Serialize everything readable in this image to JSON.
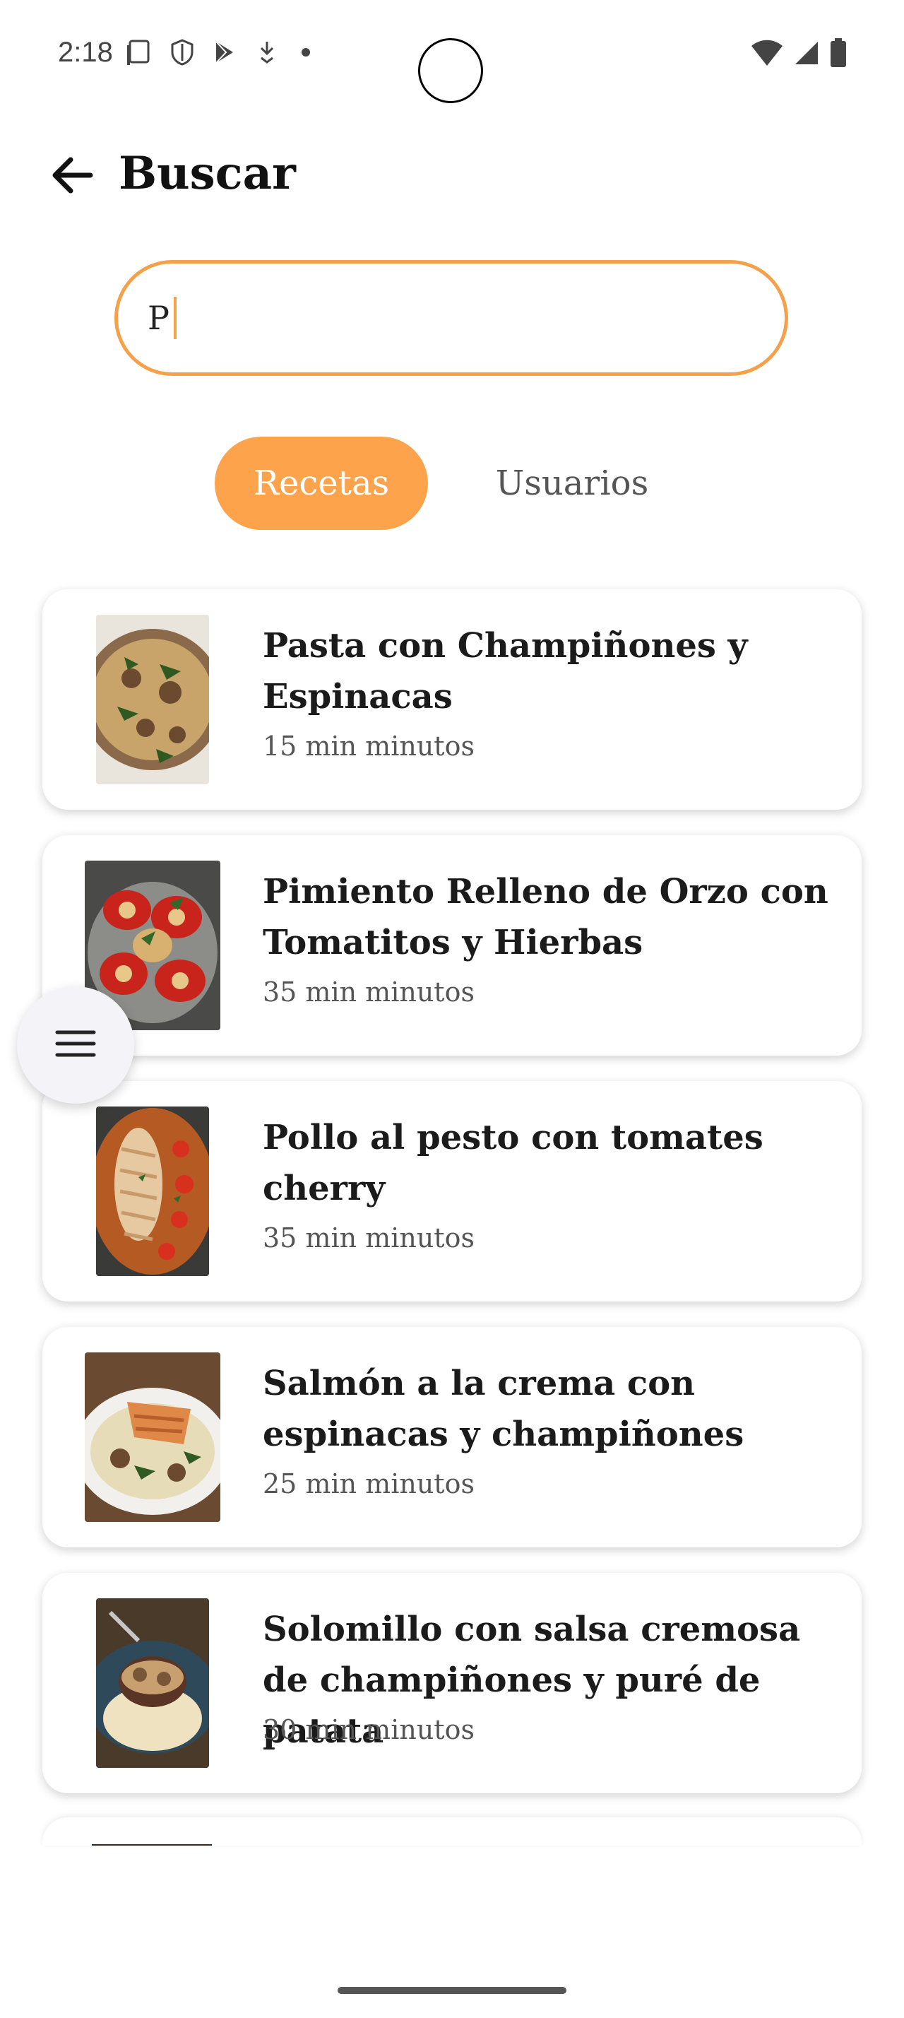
{
  "status_bar": {
    "time": "2:18",
    "icons_left": [
      "notification-screen-icon",
      "shield-icon",
      "play-store-icon",
      "download-icon",
      "dot-icon"
    ],
    "icons_right": [
      "wifi-icon",
      "signal-icon",
      "battery-icon"
    ]
  },
  "header": {
    "title": "Buscar",
    "back_icon": "arrow-left-icon"
  },
  "search": {
    "value": "P"
  },
  "tabs": [
    {
      "label": "Recetas",
      "selected": true
    },
    {
      "label": "Usuarios",
      "selected": false
    }
  ],
  "results": [
    {
      "title": "Pasta con Champiñones y Espinacas",
      "time": "15 min minutos"
    },
    {
      "title": "Pimiento Relleno de Orzo con Tomatitos y Hierbas",
      "time": "35 min minutos"
    },
    {
      "title": "Pollo al pesto con tomates cherry",
      "time": "35 min minutos"
    },
    {
      "title": "Salmón a la crema con espinacas y champiñones",
      "time": "25 min minutos"
    },
    {
      "title": "Solomillo con salsa cremosa de champiñones y puré de patata",
      "time": "30 min minutos"
    }
  ],
  "fab": {
    "icon": "menu-icon"
  },
  "colors": {
    "accent": "#fca34b",
    "search_border": "#f5a04a"
  }
}
